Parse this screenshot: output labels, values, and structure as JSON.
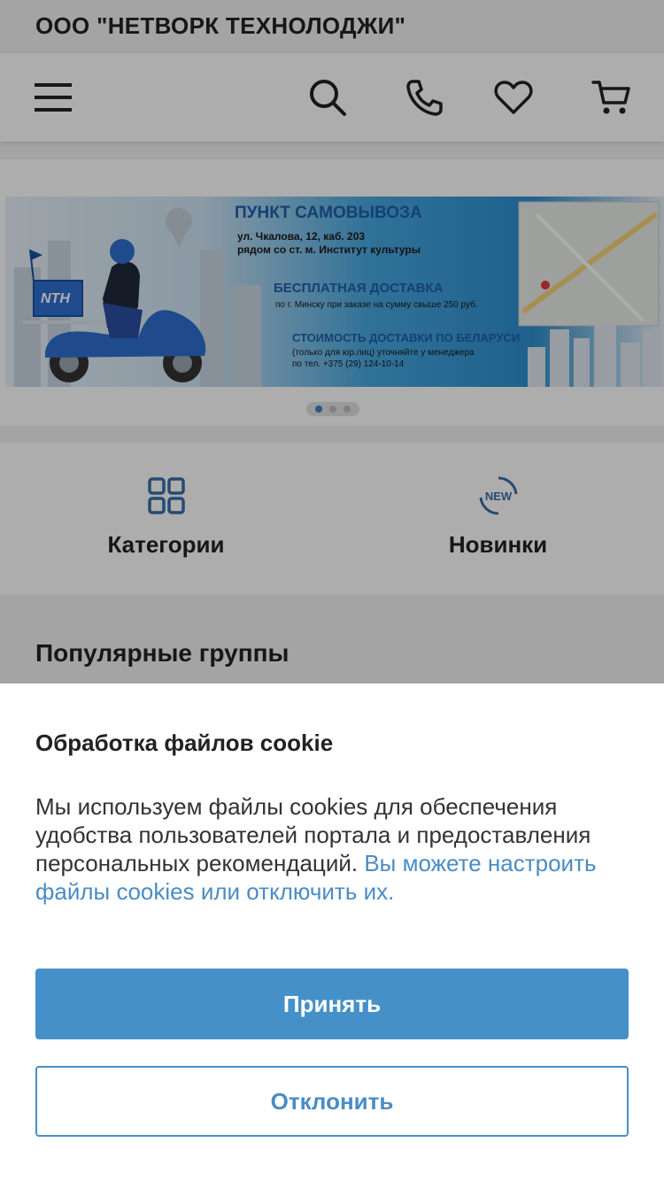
{
  "company": {
    "name": "ООО \"НЕТВОРК ТЕХНОЛОДЖИ\""
  },
  "header": {
    "icons": [
      "menu-icon",
      "search-icon",
      "phone-icon",
      "heart-icon",
      "cart-icon"
    ]
  },
  "banner": {
    "pickup_title": "ПУНКТ САМОВЫВОЗА",
    "pickup_address_line1": "ул. Чкалова, 12, каб. 203",
    "pickup_address_line2": "рядом со ст. м. Институт культуры",
    "free_delivery_title": "БЕСПЛАТНАЯ ДОСТАВКА",
    "free_delivery_text": "по г. Минску при заказе на сумму свыше 250 руб.",
    "belarus_title": "СТОИМОСТЬ ДОСТАВКИ ПО БЕЛАРУСИ",
    "belarus_line1": "(только для юр.лиц) уточняйте у менеджера",
    "belarus_line2": "по тел. +375 (29) 124-10-14",
    "logo_text": "NTH",
    "slide_count": 3,
    "active_slide": 1
  },
  "quick_links": [
    {
      "label": "Категории",
      "icon": "grid-icon"
    },
    {
      "label": "Новинки",
      "icon": "new-badge-icon",
      "icon_text": "NEW"
    }
  ],
  "popular": {
    "title": "Популярные группы"
  },
  "cookie": {
    "title": "Обработка файлов cookie",
    "text": "Мы используем файлы cookies для обеспечения удобства пользователей портала и предоставления персональных рекомендаций.",
    "link_text": "Вы можете настроить файлы cookies или отключить их.",
    "accept_label": "Принять",
    "decline_label": "Отклонить"
  },
  "colors": {
    "accent": "#4590c8",
    "link": "#4a8cc5",
    "icon_blue": "#3a6fa5",
    "text_dark": "#222222"
  }
}
